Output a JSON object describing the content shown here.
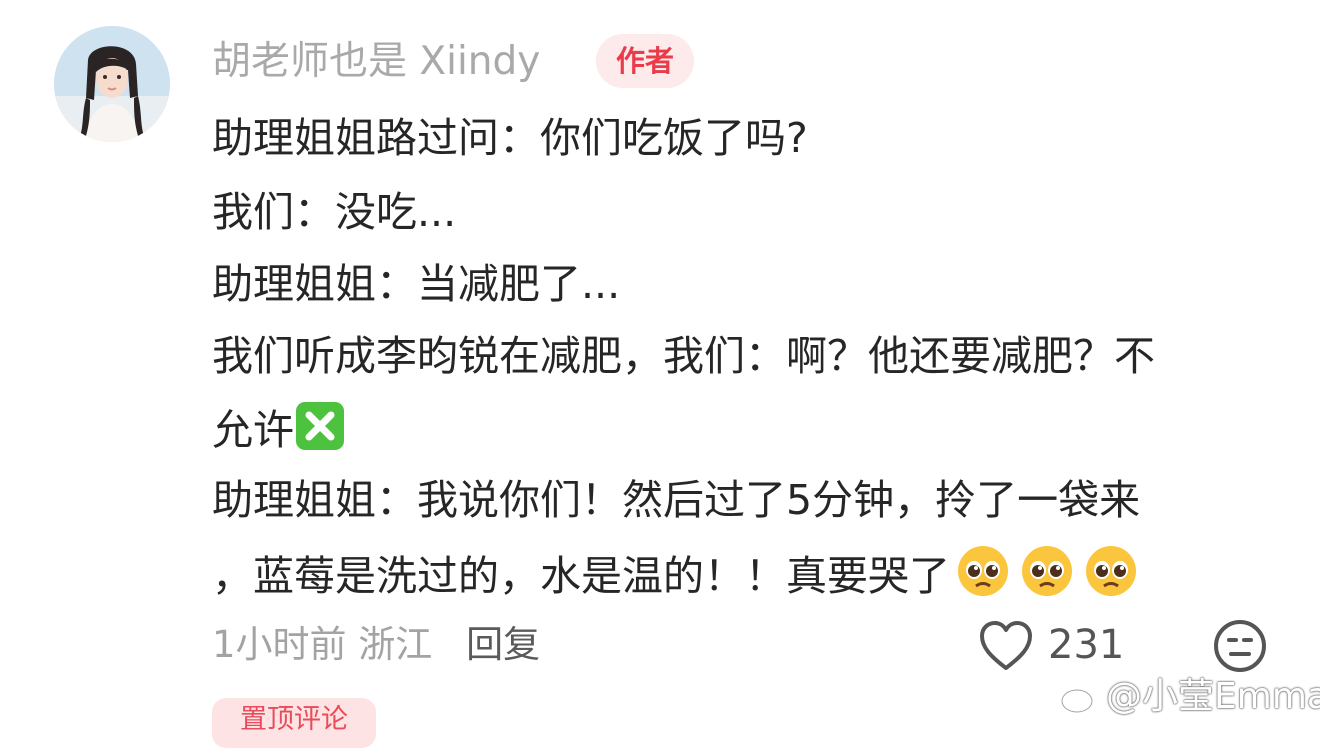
{
  "comment": {
    "author": "胡老师也是 Xiindy",
    "author_badge": "作者",
    "lines": [
      "助理姐姐路过问：你们吃饭了吗?",
      "我们：没吃...",
      "助理姐姐：当减肥了...",
      "我们听成李昀锐在减肥，我们：啊？他还要减肥？不",
      "允许",
      "助理姐姐：我说你们！然后过了5分钟，拎了一袋来",
      "，蓝莓是洗过的，水是温的！！真要哭了"
    ],
    "inline_icons": [
      "cross-mark-button-icon",
      "pleading-face-icon",
      "pleading-face-icon",
      "pleading-face-icon"
    ],
    "time": "1小时前",
    "location": "浙江",
    "reply_label": "回复",
    "like_count": "231",
    "pin_label": "置顶评论"
  },
  "watermark": "@小莹Emma",
  "colors": {
    "badge_text": "#ea3b4b",
    "badge_bg": "#fdeaea",
    "green_cross": "#4dc23f"
  }
}
